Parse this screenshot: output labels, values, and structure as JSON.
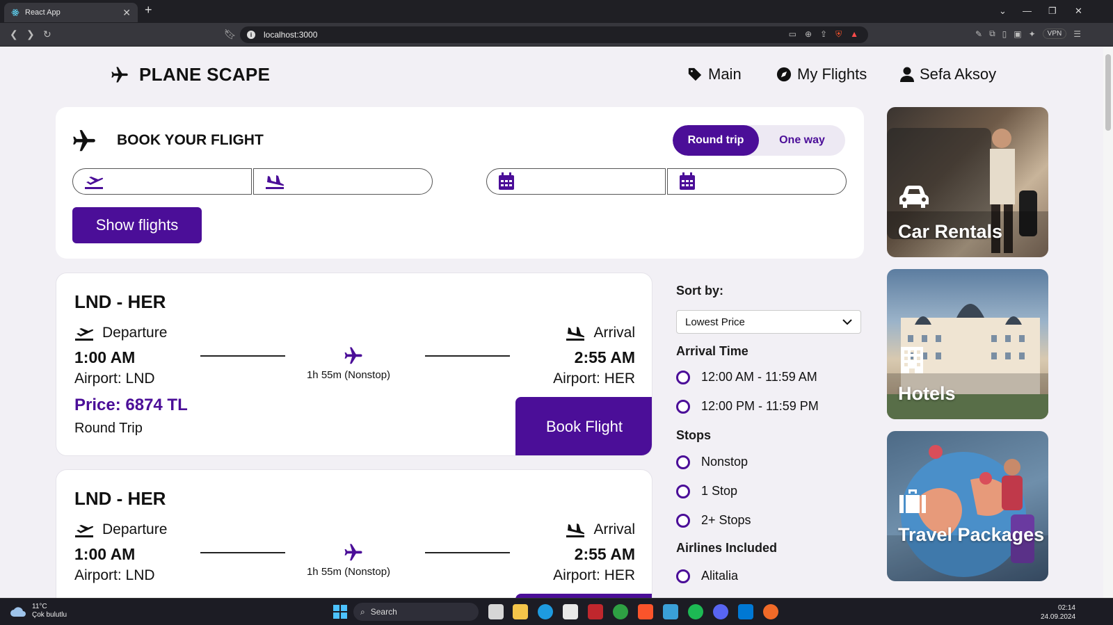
{
  "browser": {
    "tab_title": "React App",
    "url": "localhost:3000",
    "vpn_label": "VPN"
  },
  "header": {
    "brand": "PLANE SCAPE",
    "nav": [
      {
        "label": "Main",
        "icon": "tag-icon"
      },
      {
        "label": "My Flights",
        "icon": "compass-icon"
      },
      {
        "label": "Sefa Aksoy",
        "icon": "user-icon"
      }
    ]
  },
  "booking": {
    "title": "BOOK YOUR FLIGHT",
    "trip_options": [
      "Round trip",
      "One way"
    ],
    "selected_trip": "Round trip",
    "from_value": "",
    "to_value": "",
    "depart_date": "",
    "return_date": "",
    "show_button": "Show flights"
  },
  "flights": [
    {
      "route": "LND - HER",
      "departure_label": "Departure",
      "arrival_label": "Arrival",
      "departure_time": "1:00 AM",
      "arrival_time": "2:55 AM",
      "departure_airport": "Airport: LND",
      "arrival_airport": "Airport: HER",
      "duration": "1h 55m (Nonstop)",
      "price": "Price: 6874 TL",
      "trip_type": "Round Trip",
      "book_label": "Book Flight"
    },
    {
      "route": "LND - HER",
      "departure_label": "Departure",
      "arrival_label": "Arrival",
      "departure_time": "1:00 AM",
      "arrival_time": "2:55 AM",
      "departure_airport": "Airport: LND",
      "arrival_airport": "Airport: HER",
      "duration": "1h 55m (Nonstop)"
    }
  ],
  "filters": {
    "sort_label": "Sort by:",
    "sort_value": "Lowest Price",
    "arrival_time_label": "Arrival Time",
    "arrival_times": [
      "12:00 AM - 11:59 AM",
      "12:00 PM - 11:59 PM"
    ],
    "stops_label": "Stops",
    "stops": [
      "Nonstop",
      "1 Stop",
      "2+ Stops"
    ],
    "airlines_label": "Airlines Included",
    "airlines": [
      "Alitalia"
    ]
  },
  "promos": [
    {
      "label": "Car Rentals",
      "icon": "car-icon"
    },
    {
      "label": "Hotels",
      "icon": "building-icon"
    },
    {
      "label": "Travel Packages",
      "icon": "suitcase-icon"
    }
  ],
  "taskbar": {
    "temperature": "11°C",
    "weather": "Çok bulutlu",
    "search": "Search",
    "time": "02:14",
    "date": "24.09.2024"
  },
  "colors": {
    "accent": "#4b0e98",
    "page_bg": "#f2f0f5"
  }
}
